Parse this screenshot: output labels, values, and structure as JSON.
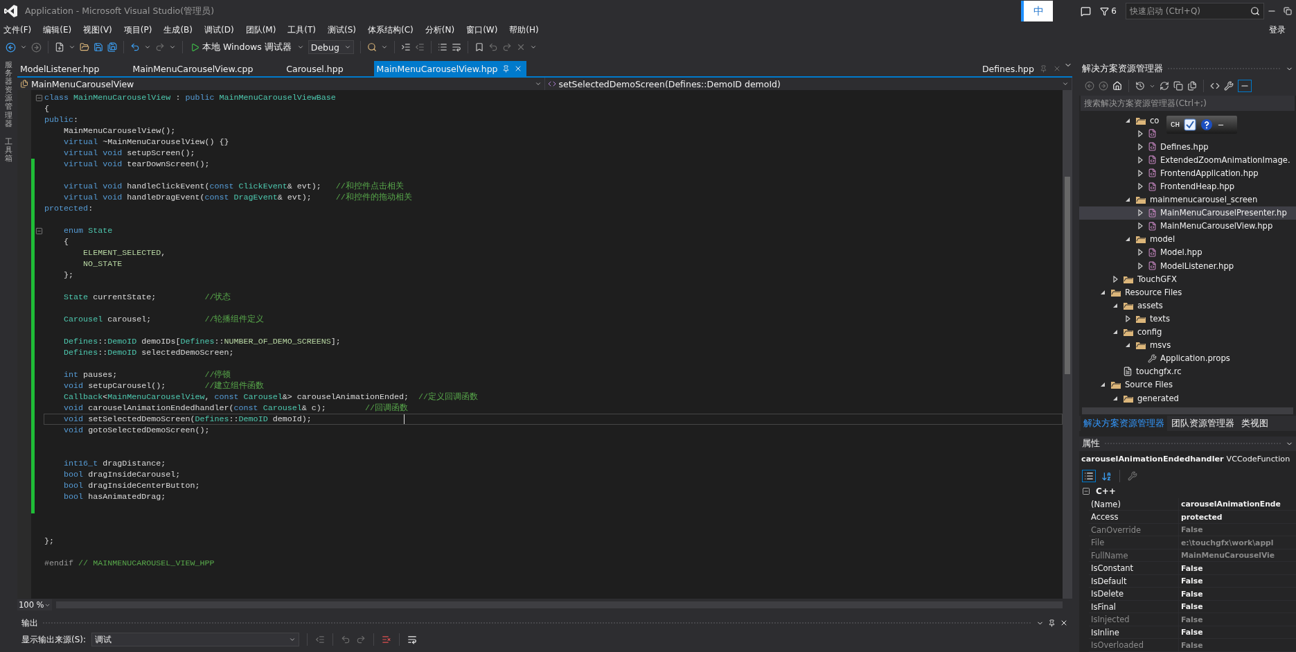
{
  "title_bar": {
    "title": "Application - Microsoft Visual Studio(管理员)",
    "ime": "中",
    "notifications": "6",
    "quick_launch": {
      "placeholder": "快速启动 (Ctrl+Q)"
    },
    "sign_in": "登录"
  },
  "menu": [
    "文件(F)",
    "编辑(E)",
    "视图(V)",
    "项目(P)",
    "生成(B)",
    "调试(D)",
    "团队(M)",
    "工具(T)",
    "测试(S)",
    "体系结构(C)",
    "分析(N)",
    "窗口(W)",
    "帮助(H)"
  ],
  "toolbar": {
    "debugger": "本地 Windows 调试器",
    "configuration": "Debug"
  },
  "side_strip": [
    "服务器资源管理器",
    "工具箱"
  ],
  "doc_tabs": [
    {
      "label": "ModelListener.hpp",
      "selected": false
    },
    {
      "label": "MainMenuCarouselView.cpp",
      "selected": false
    },
    {
      "label": "Carousel.hpp",
      "selected": false
    },
    {
      "label": "MainMenuCarouselView.hpp",
      "selected": true
    }
  ],
  "pinned_tab": "Defines.hpp",
  "nav_bar": {
    "scope": "MainMenuCarouselView",
    "member": "setSelectedDemoScreen(Defines::DemoID demoId)"
  },
  "code": {
    "lines": [
      {
        "fold": true,
        "changed": false,
        "current": false,
        "tokens": [
          {
            "kind": "keyword",
            "text": "class "
          },
          {
            "kind": "type",
            "text": "MainMenuCarouselView"
          },
          {
            "kind": "plain",
            "text": " : "
          },
          {
            "kind": "keyword",
            "text": "public "
          },
          {
            "kind": "type",
            "text": "MainMenuCarouselViewBase"
          }
        ]
      },
      {
        "fold": false,
        "changed": false,
        "current": false,
        "tokens": [
          {
            "kind": "plain",
            "text": "{"
          }
        ]
      },
      {
        "fold": false,
        "changed": false,
        "current": false,
        "tokens": [
          {
            "kind": "keyword",
            "text": "public"
          },
          {
            "kind": "plain",
            "text": ":"
          }
        ]
      },
      {
        "fold": false,
        "changed": false,
        "current": false,
        "tokens": [
          {
            "kind": "plain",
            "text": "    MainMenuCarouselView();"
          }
        ]
      },
      {
        "fold": false,
        "changed": false,
        "current": false,
        "tokens": [
          {
            "kind": "keyword",
            "text": "    virtual "
          },
          {
            "kind": "plain",
            "text": "~MainMenuCarouselView() {}"
          }
        ]
      },
      {
        "fold": false,
        "changed": false,
        "current": false,
        "tokens": [
          {
            "kind": "keyword",
            "text": "    virtual void "
          },
          {
            "kind": "plain",
            "text": "setupScreen();"
          }
        ]
      },
      {
        "fold": false,
        "changed": true,
        "current": false,
        "tokens": [
          {
            "kind": "keyword",
            "text": "    virtual void "
          },
          {
            "kind": "plain",
            "text": "tearDownScreen();"
          }
        ]
      },
      {
        "fold": false,
        "changed": true,
        "current": false
      },
      {
        "fold": false,
        "changed": true,
        "current": false,
        "tokens": [
          {
            "kind": "keyword",
            "text": "    virtual void "
          },
          {
            "kind": "plain",
            "text": "handleClickEvent("
          },
          {
            "kind": "keyword",
            "text": "const "
          },
          {
            "kind": "type",
            "text": "ClickEvent"
          },
          {
            "kind": "plain",
            "text": "& evt);   "
          },
          {
            "kind": "comment",
            "text": "//和控件点击相关"
          }
        ]
      },
      {
        "fold": false,
        "changed": true,
        "current": false,
        "tokens": [
          {
            "kind": "keyword",
            "text": "    virtual void "
          },
          {
            "kind": "plain",
            "text": "handleDragEvent("
          },
          {
            "kind": "keyword",
            "text": "const "
          },
          {
            "kind": "type",
            "text": "DragEvent"
          },
          {
            "kind": "plain",
            "text": "& evt);     "
          },
          {
            "kind": "comment",
            "text": "//和控件的拖动相关"
          }
        ]
      },
      {
        "fold": false,
        "changed": true,
        "current": false,
        "tokens": [
          {
            "kind": "keyword",
            "text": "protected"
          },
          {
            "kind": "plain",
            "text": ":"
          }
        ]
      },
      {
        "fold": false,
        "changed": true,
        "current": false
      },
      {
        "fold": true,
        "changed": true,
        "current": false,
        "tokens": [
          {
            "kind": "keyword",
            "text": "    enum "
          },
          {
            "kind": "type",
            "text": "State"
          }
        ]
      },
      {
        "fold": false,
        "changed": true,
        "current": false,
        "tokens": [
          {
            "kind": "plain",
            "text": "    {"
          }
        ]
      },
      {
        "fold": false,
        "changed": true,
        "current": false,
        "tokens": [
          {
            "kind": "enum",
            "text": "        ELEMENT_SELECTED"
          },
          {
            "kind": "plain",
            "text": ","
          }
        ]
      },
      {
        "fold": false,
        "changed": true,
        "current": false,
        "tokens": [
          {
            "kind": "enum",
            "text": "        NO_STATE"
          }
        ]
      },
      {
        "fold": false,
        "changed": true,
        "current": false,
        "tokens": [
          {
            "kind": "plain",
            "text": "    };"
          }
        ]
      },
      {
        "fold": false,
        "changed": true,
        "current": false
      },
      {
        "fold": false,
        "changed": true,
        "current": false,
        "tokens": [
          {
            "kind": "type",
            "text": "    State "
          },
          {
            "kind": "plain",
            "text": "currentState;          "
          },
          {
            "kind": "comment",
            "text": "//状态"
          }
        ]
      },
      {
        "fold": false,
        "changed": true,
        "current": false
      },
      {
        "fold": false,
        "changed": true,
        "current": false,
        "tokens": [
          {
            "kind": "type",
            "text": "    Carousel "
          },
          {
            "kind": "plain",
            "text": "carousel;           "
          },
          {
            "kind": "comment",
            "text": "//轮播组件定义"
          }
        ]
      },
      {
        "fold": false,
        "changed": true,
        "current": false
      },
      {
        "fold": false,
        "changed": true,
        "current": false,
        "tokens": [
          {
            "kind": "type",
            "text": "    Defines"
          },
          {
            "kind": "plain",
            "text": "::"
          },
          {
            "kind": "type",
            "text": "DemoID "
          },
          {
            "kind": "plain",
            "text": "demoIDs["
          },
          {
            "kind": "type",
            "text": "Defines"
          },
          {
            "kind": "plain",
            "text": "::"
          },
          {
            "kind": "enum",
            "text": "NUMBER_OF_DEMO_SCREENS"
          },
          {
            "kind": "plain",
            "text": "];"
          }
        ]
      },
      {
        "fold": false,
        "changed": true,
        "current": false,
        "tokens": [
          {
            "kind": "type",
            "text": "    Defines"
          },
          {
            "kind": "plain",
            "text": "::"
          },
          {
            "kind": "type",
            "text": "DemoID "
          },
          {
            "kind": "plain",
            "text": "selectedDemoScreen;"
          }
        ]
      },
      {
        "fold": false,
        "changed": true,
        "current": false
      },
      {
        "fold": false,
        "changed": true,
        "current": false,
        "tokens": [
          {
            "kind": "keyword",
            "text": "    int "
          },
          {
            "kind": "plain",
            "text": "pauses;                  "
          },
          {
            "kind": "comment",
            "text": "//停顿"
          }
        ]
      },
      {
        "fold": false,
        "changed": true,
        "current": false,
        "tokens": [
          {
            "kind": "keyword",
            "text": "    void "
          },
          {
            "kind": "plain",
            "text": "setupCarousel();        "
          },
          {
            "kind": "comment",
            "text": "//建立组件函数"
          }
        ]
      },
      {
        "fold": false,
        "changed": true,
        "current": false,
        "tokens": [
          {
            "kind": "type",
            "text": "    Callback"
          },
          {
            "kind": "plain",
            "text": "<"
          },
          {
            "kind": "type",
            "text": "MainMenuCarouselView"
          },
          {
            "kind": "plain",
            "text": ", "
          },
          {
            "kind": "keyword",
            "text": "const "
          },
          {
            "kind": "type",
            "text": "Carousel"
          },
          {
            "kind": "plain",
            "text": "&> carouselAnimationEnded;  "
          },
          {
            "kind": "comment",
            "text": "//定义回调函数"
          }
        ]
      },
      {
        "fold": false,
        "changed": true,
        "current": false,
        "tokens": [
          {
            "kind": "keyword",
            "text": "    void "
          },
          {
            "kind": "plain",
            "text": "carouselAnimationEndedhandler("
          },
          {
            "kind": "keyword",
            "text": "const "
          },
          {
            "kind": "type",
            "text": "Carousel"
          },
          {
            "kind": "plain",
            "text": "& c);        "
          },
          {
            "kind": "comment",
            "text": "//回调函数"
          }
        ]
      },
      {
        "fold": false,
        "changed": true,
        "current": true,
        "tokens": [
          {
            "kind": "keyword",
            "text": "    void "
          },
          {
            "kind": "plain",
            "text": "setSelectedDemoScreen("
          },
          {
            "kind": "type",
            "text": "Defines"
          },
          {
            "kind": "plain",
            "text": "::"
          },
          {
            "kind": "type",
            "text": "DemoID "
          },
          {
            "kind": "plain",
            "text": "demoId);"
          }
        ]
      },
      {
        "fold": false,
        "changed": true,
        "current": false,
        "tokens": [
          {
            "kind": "keyword",
            "text": "    void "
          },
          {
            "kind": "plain",
            "text": "gotoSelectedDemoScreen();"
          }
        ]
      },
      {
        "fold": false,
        "changed": true,
        "current": false
      },
      {
        "fold": false,
        "changed": true,
        "current": false
      },
      {
        "fold": false,
        "changed": true,
        "current": false,
        "tokens": [
          {
            "kind": "keyword",
            "text": "    int16_t "
          },
          {
            "kind": "plain",
            "text": "dragDistance;"
          }
        ]
      },
      {
        "fold": false,
        "changed": true,
        "current": false,
        "tokens": [
          {
            "kind": "keyword",
            "text": "    bool "
          },
          {
            "kind": "plain",
            "text": "dragInsideCarousel;"
          }
        ]
      },
      {
        "fold": false,
        "changed": true,
        "current": false,
        "tokens": [
          {
            "kind": "keyword",
            "text": "    bool "
          },
          {
            "kind": "plain",
            "text": "dragInsideCenterButton;"
          }
        ]
      },
      {
        "fold": false,
        "changed": true,
        "current": false,
        "tokens": [
          {
            "kind": "keyword",
            "text": "    bool "
          },
          {
            "kind": "plain",
            "text": "hasAnimatedDrag;"
          }
        ]
      },
      {
        "fold": false,
        "changed": true,
        "current": false
      },
      {
        "fold": false,
        "changed": false,
        "current": false
      },
      {
        "fold": false,
        "changed": false,
        "current": false
      },
      {
        "fold": false,
        "changed": false,
        "current": false,
        "tokens": [
          {
            "kind": "plain",
            "text": "};"
          }
        ]
      },
      {
        "fold": false,
        "changed": false,
        "current": false
      },
      {
        "fold": false,
        "changed": false,
        "current": false,
        "tokens": [
          {
            "kind": "directive",
            "text": "#endif "
          },
          {
            "kind": "comment",
            "text": "// MAINMENUCAROUSEL_VIEW_HPP"
          }
        ]
      }
    ]
  },
  "zoom": "100 %",
  "output": {
    "title": "输出",
    "source_label": "显示输出来源(S):",
    "source": "调试"
  },
  "solution_explorer": {
    "title": "解决方案资源管理器",
    "search": {
      "placeholder": "搜索解决方案资源管理器(Ctrl+;)"
    },
    "tree": [
      {
        "children": [
          {
            "children": [
              {
                "kind": "folder",
                "label": "co",
                "expanded": true,
                "selected": false,
                "children": [
                  {
                    "kind": "file",
                    "expanded": false,
                    "selected": false
                  },
                  {
                    "kind": "file",
                    "label": "Defines.hpp",
                    "expanded": false,
                    "selected": false
                  },
                  {
                    "kind": "file",
                    "label": "ExtendedZoomAnimationImage.",
                    "expanded": false,
                    "selected": false
                  },
                  {
                    "kind": "file",
                    "label": "FrontendApplication.hpp",
                    "expanded": false,
                    "selected": false
                  },
                  {
                    "kind": "file",
                    "label": "FrontendHeap.hpp",
                    "expanded": false,
                    "selected": false
                  }
                ]
              },
              {
                "kind": "folder",
                "label": "mainmenucarousel_screen",
                "expanded": true,
                "selected": false,
                "children": [
                  {
                    "kind": "file",
                    "label": "MainMenuCarouselPresenter.hp",
                    "expanded": false,
                    "selected": true
                  },
                  {
                    "kind": "file",
                    "label": "MainMenuCarouselView.hpp",
                    "expanded": false,
                    "selected": false
                  }
                ]
              },
              {
                "kind": "folder",
                "label": "model",
                "expanded": true,
                "selected": false,
                "children": [
                  {
                    "kind": "file",
                    "label": "Model.hpp",
                    "expanded": false,
                    "selected": false
                  },
                  {
                    "kind": "file",
                    "label": "ModelListener.hpp",
                    "expanded": false,
                    "selected": false
                  }
                ]
              }
            ]
          },
          {
            "kind": "folder",
            "label": "TouchGFX",
            "expanded": false,
            "selected": false
          }
        ]
      },
      {
        "kind": "folder",
        "label": "Resource Files",
        "expanded": true,
        "selected": false,
        "children": [
          {
            "kind": "folder",
            "label": "assets",
            "expanded": true,
            "selected": false,
            "children": [
              {
                "kind": "folder",
                "label": "texts",
                "expanded": false,
                "selected": false
              }
            ]
          },
          {
            "kind": "folder",
            "label": "config",
            "expanded": true,
            "selected": false,
            "children": [
              {
                "kind": "folder",
                "label": "msvs",
                "expanded": true,
                "selected": false,
                "children": [
                  {
                    "kind": "props",
                    "label": "Application.props",
                    "selected": false
                  }
                ]
              }
            ]
          },
          {
            "kind": "resource",
            "label": "touchgfx.rc",
            "selected": false
          }
        ]
      },
      {
        "kind": "folder",
        "label": "Source Files",
        "expanded": true,
        "selected": false,
        "children": [
          {
            "kind": "folder",
            "label": "generated",
            "expanded": true,
            "selected": false
          }
        ]
      }
    ]
  },
  "ime_bar": {
    "label": "CH"
  },
  "panel_tabs": [
    {
      "label": "解决方案资源管理器",
      "selected": true
    },
    {
      "label": "团队资源管理器",
      "selected": false
    },
    {
      "label": "类视图",
      "selected": false
    }
  ],
  "properties": {
    "title": "属性",
    "object": "carouselAnimationEndedhandler",
    "object_type": "VCCodeFunction",
    "category": {
      "label": "C++",
      "expanded": true
    },
    "rows": [
      {
        "name": "(Name)",
        "value": "carouselAnimationEnde",
        "readonly": false
      },
      {
        "name": "Access",
        "value": "protected",
        "readonly": false
      },
      {
        "name": "CanOverride",
        "value": "False",
        "readonly": true
      },
      {
        "name": "File",
        "value": "e:\\touchgfx\\work\\appl",
        "readonly": true
      },
      {
        "name": "FullName",
        "value": "MainMenuCarouselVie",
        "readonly": true
      },
      {
        "name": "IsConstant",
        "value": "False",
        "readonly": false
      },
      {
        "name": "IsDefault",
        "value": "False",
        "readonly": false
      },
      {
        "name": "IsDelete",
        "value": "False",
        "readonly": false
      },
      {
        "name": "IsFinal",
        "value": "False",
        "readonly": false
      },
      {
        "name": "IsInjected",
        "value": "False",
        "readonly": true
      },
      {
        "name": "IsInline",
        "value": "False",
        "readonly": false
      },
      {
        "name": "IsOverloaded",
        "value": "False",
        "readonly": true
      }
    ]
  }
}
